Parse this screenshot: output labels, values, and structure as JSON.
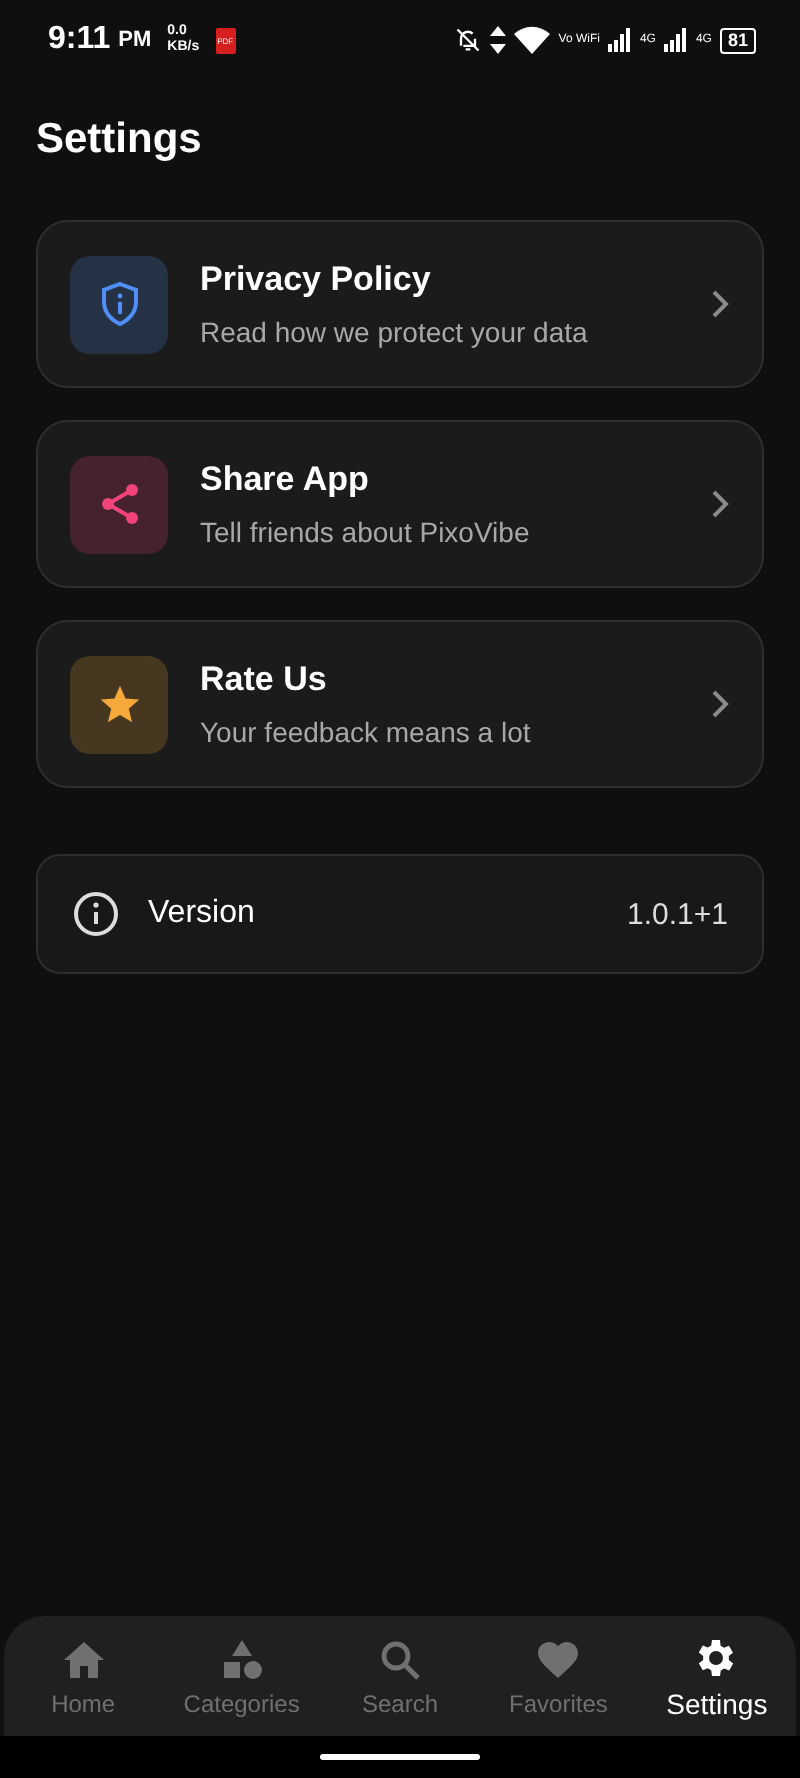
{
  "status_bar": {
    "time": "9:11",
    "ampm": "PM",
    "speed_value": "0.0",
    "speed_unit": "KB/s",
    "notification_badge": "PDF",
    "wifi_calling": "Vo WiFi",
    "network_1": "4G",
    "network_2": "4G",
    "battery": "81"
  },
  "title": "Settings",
  "items": [
    {
      "title": "Privacy Policy",
      "subtitle": "Read how we protect your data",
      "color": "#4f8ff7"
    },
    {
      "title": "Share App",
      "subtitle": "Tell friends about PixoVibe",
      "color": "#f0437a"
    },
    {
      "title": "Rate Us",
      "subtitle": "Your feedback means a lot",
      "color": "#f5a93a"
    }
  ],
  "version": {
    "label": "Version",
    "value": "1.0.1+1"
  },
  "nav": [
    {
      "label": "Home",
      "selected": false
    },
    {
      "label": "Categories",
      "selected": false
    },
    {
      "label": "Search",
      "selected": false
    },
    {
      "label": "Favorites",
      "selected": false
    },
    {
      "label": "Settings",
      "selected": true
    }
  ]
}
